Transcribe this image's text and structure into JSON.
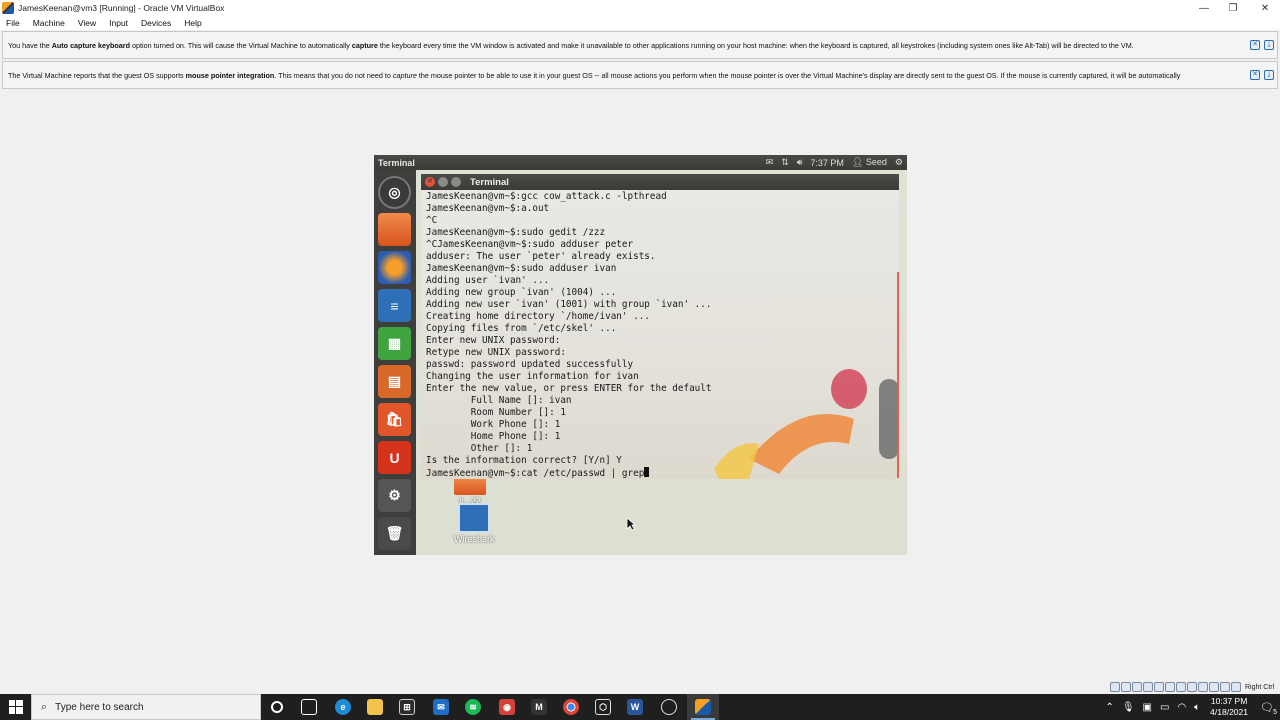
{
  "window": {
    "title": "JamesKeenan@vm3 [Running] - Oracle VM VirtualBox",
    "minimize": "—",
    "restore": "❐",
    "close": "✕"
  },
  "menu": [
    "File",
    "Machine",
    "View",
    "Input",
    "Devices",
    "Help"
  ],
  "notices": [
    {
      "pre": "You have the ",
      "b1": "Auto capture keyboard",
      "mid1": " option turned on. This will cause the Virtual Machine to automatically ",
      "b2": "capture",
      "post": " the keyboard every time the VM window is activated and make it unavailable to other applications running on your host machine: when the keyboard is captured, all keystrokes (including system ones like Alt-Tab) will be directed to the VM."
    },
    {
      "pre": "The Virtual Machine reports that the guest OS supports ",
      "b1": "mouse pointer integration",
      "mid1": ". This means that you do not need to ",
      "i1": "capture",
      "post": " the mouse pointer to be able to use it in your guest OS -- all mouse actions you perform when the mouse pointer is over the Virtual Machine's display are directly sent to the guest OS. If the mouse is currently captured, it will be automatically"
    }
  ],
  "guest": {
    "panel_title": "Terminal",
    "time": "7:37 PM",
    "user": "Seed",
    "terminal_title": "Terminal",
    "lines": [
      "JamesKeenan@vm~$:gcc cow_attack.c -lpthread",
      "JamesKeenan@vm~$:a.out",
      "^C",
      "JamesKeenan@vm~$:sudo gedit /zzz",
      "^CJamesKeenan@vm~$:sudo adduser peter",
      "adduser: The user `peter' already exists.",
      "JamesKeenan@vm~$:sudo adduser ivan",
      "Adding user `ivan' ...",
      "Adding new group `ivan' (1004) ...",
      "Adding new user `ivan' (1001) with group `ivan' ...",
      "Creating home directory `/home/ivan' ...",
      "Copying files from `/etc/skel' ...",
      "Enter new UNIX password:",
      "Retype new UNIX password:",
      "passwd: password updated successfully",
      "Changing the user information for ivan",
      "Enter the new value, or press ENTER for the default",
      "        Full Name []: ivan",
      "        Room Number []: 1",
      "        Work Phone []: 1",
      "        Home Phone []: 1",
      "        Other []: 1",
      "Is the information correct? [Y/n] Y",
      "JamesKeenan@vm~$:cat /etc/passwd | grep"
    ],
    "desktop_icons": [
      {
        "label": "li...22"
      },
      {
        "label": "Wireshark"
      }
    ]
  },
  "taskbar": {
    "search_placeholder": "Type here to search",
    "time": "10:37 PM",
    "date": "4/18/2021",
    "notification_count": "5",
    "host_key": "Right Ctrl"
  }
}
